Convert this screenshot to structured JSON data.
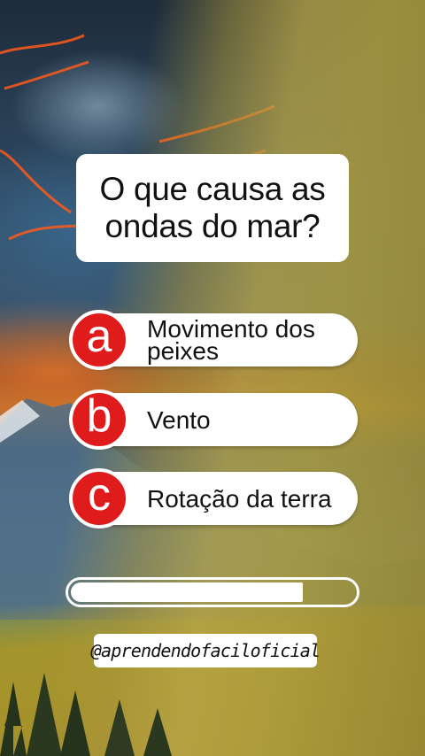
{
  "quiz": {
    "question": "O que causa as ondas do mar?",
    "options": [
      {
        "letter": "a",
        "text": "Movimento dos peixes"
      },
      {
        "letter": "b",
        "text": "Vento"
      },
      {
        "letter": "c",
        "text": "Rotação da terra"
      }
    ],
    "timer_progress": 0.82,
    "handle": "@aprendendofaciloficial"
  },
  "colors": {
    "badge": "#e01b1b",
    "card": "#ffffff"
  }
}
